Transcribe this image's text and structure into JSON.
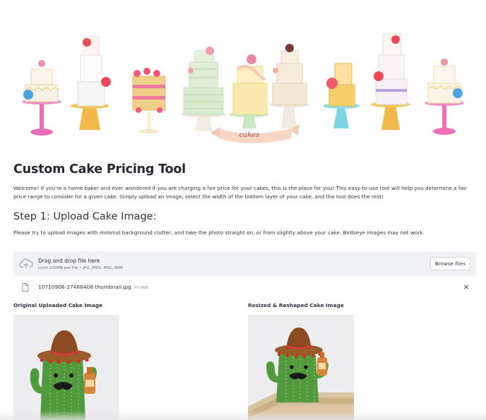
{
  "banner": {
    "ribbon_text": "cakes"
  },
  "page": {
    "title": "Custom Cake Pricing Tool",
    "intro": "Welcome! If you're a home baker and ever wondered if you are charging a fair price for your cakes, this is the place for you! This easy-to-use tool will help you determine a fair price range to consider for a given cake. Simply upload an image, select the width of the bottom layer of your cake, and the tool does the rest!",
    "step1_heading": "Step 1: Upload Cake Image:",
    "step1_desc": "Please try to upload images with minimal background clutter, and take the photo straight on, or from slightly above your cake. Birdseye images may not work."
  },
  "uploader": {
    "drop_label": "Drag and drop file here",
    "limit_text": "Limit 200MB per file • JPG, JPEG, PNG, BMP",
    "browse_label": "Browse files",
    "upload_icon": "cloud-upload-icon"
  },
  "uploaded_file": {
    "name": "10710906-27486408-thumbnail.jpg",
    "size": "47.6KB",
    "close_glyph": "×"
  },
  "images": {
    "original_caption": "Original Uploaded Cake Image",
    "resized_caption": "Resized & Reshaped Cake Image"
  }
}
